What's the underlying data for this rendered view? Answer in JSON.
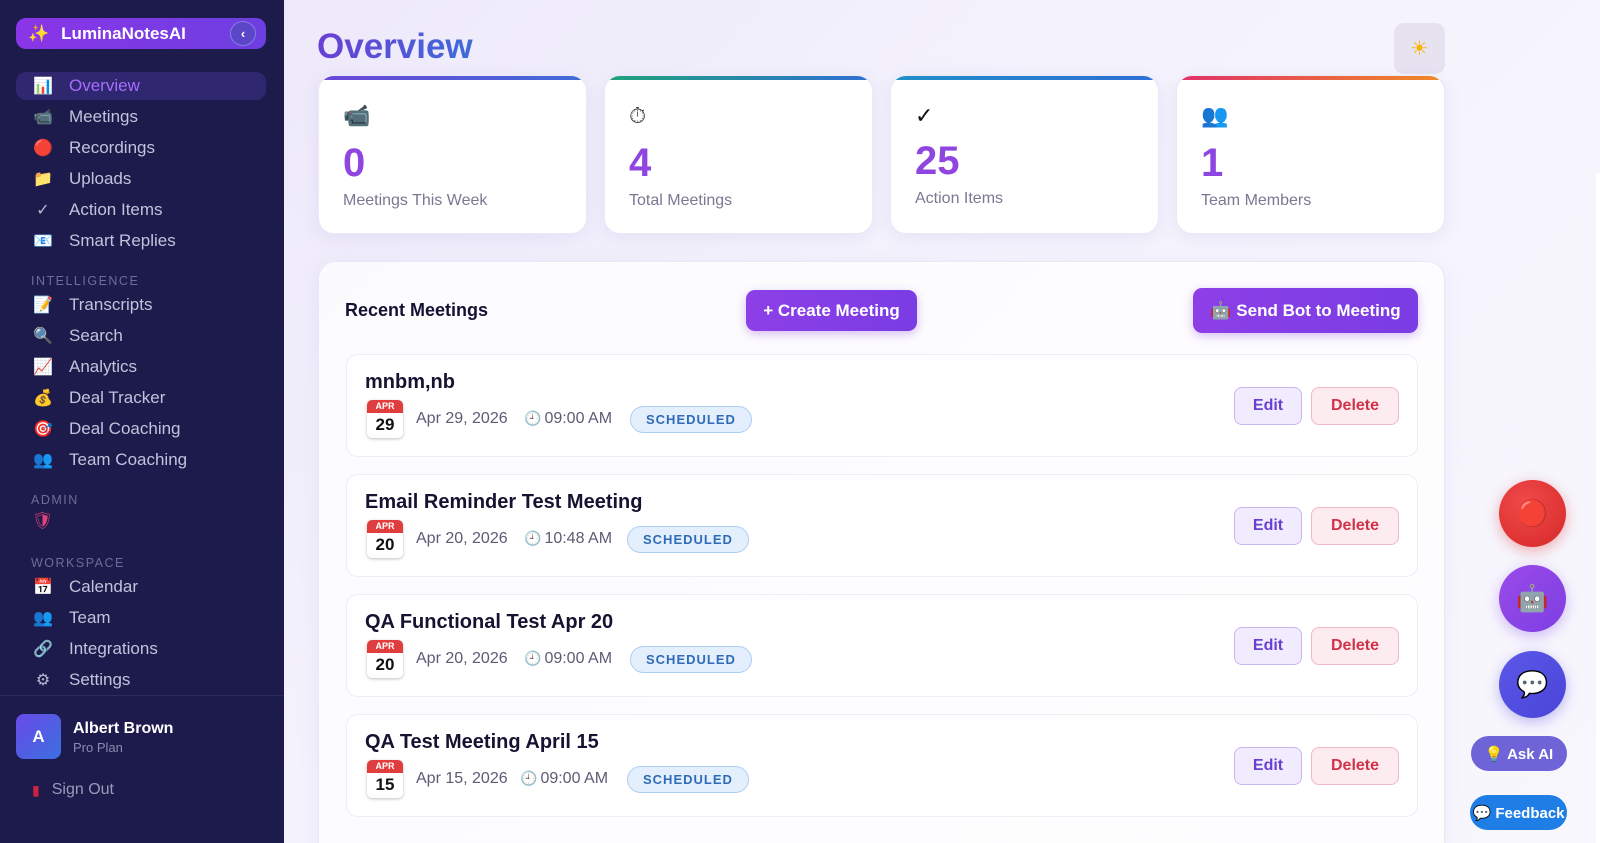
{
  "brand": {
    "name": "LuminaNotesAI",
    "icon": "sparkles-icon",
    "collapse_icon": "chevron-left-icon"
  },
  "nav": {
    "main": [
      {
        "label": "Overview",
        "icon": "bar-chart-icon",
        "glyph": "📊",
        "active": true
      },
      {
        "label": "Meetings",
        "icon": "video-camera-icon",
        "glyph": "📹"
      },
      {
        "label": "Recordings",
        "icon": "record-icon",
        "glyph": "🔴"
      },
      {
        "label": "Uploads",
        "icon": "folder-icon",
        "glyph": "📁"
      },
      {
        "label": "Action Items",
        "icon": "checkmark-icon",
        "glyph": "✓"
      },
      {
        "label": "Smart Replies",
        "icon": "email-icon",
        "glyph": "📧"
      }
    ],
    "intelligence_label": "INTELLIGENCE",
    "intelligence": [
      {
        "label": "Transcripts",
        "icon": "memo-icon",
        "glyph": "📝"
      },
      {
        "label": "Search",
        "icon": "magnifier-icon",
        "glyph": "🔍"
      },
      {
        "label": "Analytics",
        "icon": "trending-chart-icon",
        "glyph": "📈"
      },
      {
        "label": "Deal Tracker",
        "icon": "money-bag-icon",
        "glyph": "💰"
      },
      {
        "label": "Deal Coaching",
        "icon": "target-icon",
        "glyph": "🎯"
      },
      {
        "label": "Team Coaching",
        "icon": "people-icon",
        "glyph": "👥"
      }
    ],
    "admin_label": "ADMIN",
    "admin_icon": "shield-icon",
    "workspace_label": "WORKSPACE",
    "workspace": [
      {
        "label": "Calendar",
        "icon": "calendar-icon",
        "glyph": "📅"
      },
      {
        "label": "Team",
        "icon": "people-icon",
        "glyph": "👥"
      },
      {
        "label": "Integrations",
        "icon": "link-icon",
        "glyph": "🔗"
      },
      {
        "label": "Settings",
        "icon": "gear-icon",
        "glyph": "⚙"
      }
    ]
  },
  "user": {
    "initial": "A",
    "name": "Albert Brown",
    "plan": "Pro Plan",
    "sign_out": "Sign Out"
  },
  "header": {
    "title": "Overview",
    "theme_icon": "sun-icon"
  },
  "stats": [
    {
      "icon": "video-camera-icon",
      "glyph": "📹",
      "value": "0",
      "label": "Meetings This Week",
      "accent": "#6b46d8"
    },
    {
      "icon": "stopwatch-icon",
      "glyph": "⏱",
      "value": "4",
      "label": "Total Meetings",
      "accent": "#1fa37a"
    },
    {
      "icon": "checkmark-icon",
      "glyph": "✓",
      "value": "25",
      "label": "Action Items",
      "accent": "#2f6fd6"
    },
    {
      "icon": "people-icon",
      "glyph": "👥",
      "value": "1",
      "label": "Team Members",
      "accent": "#e0306a"
    }
  ],
  "recent": {
    "title": "Recent Meetings",
    "create_label": "+ Create Meeting",
    "bot_label": "🤖 Send Bot to Meeting",
    "edit_label": "Edit",
    "delete_label": "Delete",
    "meetings": [
      {
        "title": "mnbm,nb",
        "month": "APR",
        "day": "29",
        "date": "Apr 29, 2026",
        "time": "09:00 AM",
        "status": "SCHEDULED"
      },
      {
        "title": "Email Reminder Test Meeting",
        "month": "APR",
        "day": "20",
        "date": "Apr 20, 2026",
        "time": "10:48 AM",
        "status": "SCHEDULED"
      },
      {
        "title": "QA Functional Test Apr 20",
        "month": "APR",
        "day": "20",
        "date": "Apr 20, 2026",
        "time": "09:00 AM",
        "status": "SCHEDULED"
      },
      {
        "title": "QA Test Meeting April 15",
        "month": "APR",
        "day": "15",
        "date": "Apr 15, 2026",
        "time": "09:00 AM",
        "status": "SCHEDULED"
      }
    ]
  },
  "floating": {
    "record_icon": "record-icon",
    "bot_icon": "robot-icon",
    "chat_icon": "chat-bubble-icon",
    "ask_ai": "💡 Ask AI",
    "feedback": "💬 Feedback"
  }
}
